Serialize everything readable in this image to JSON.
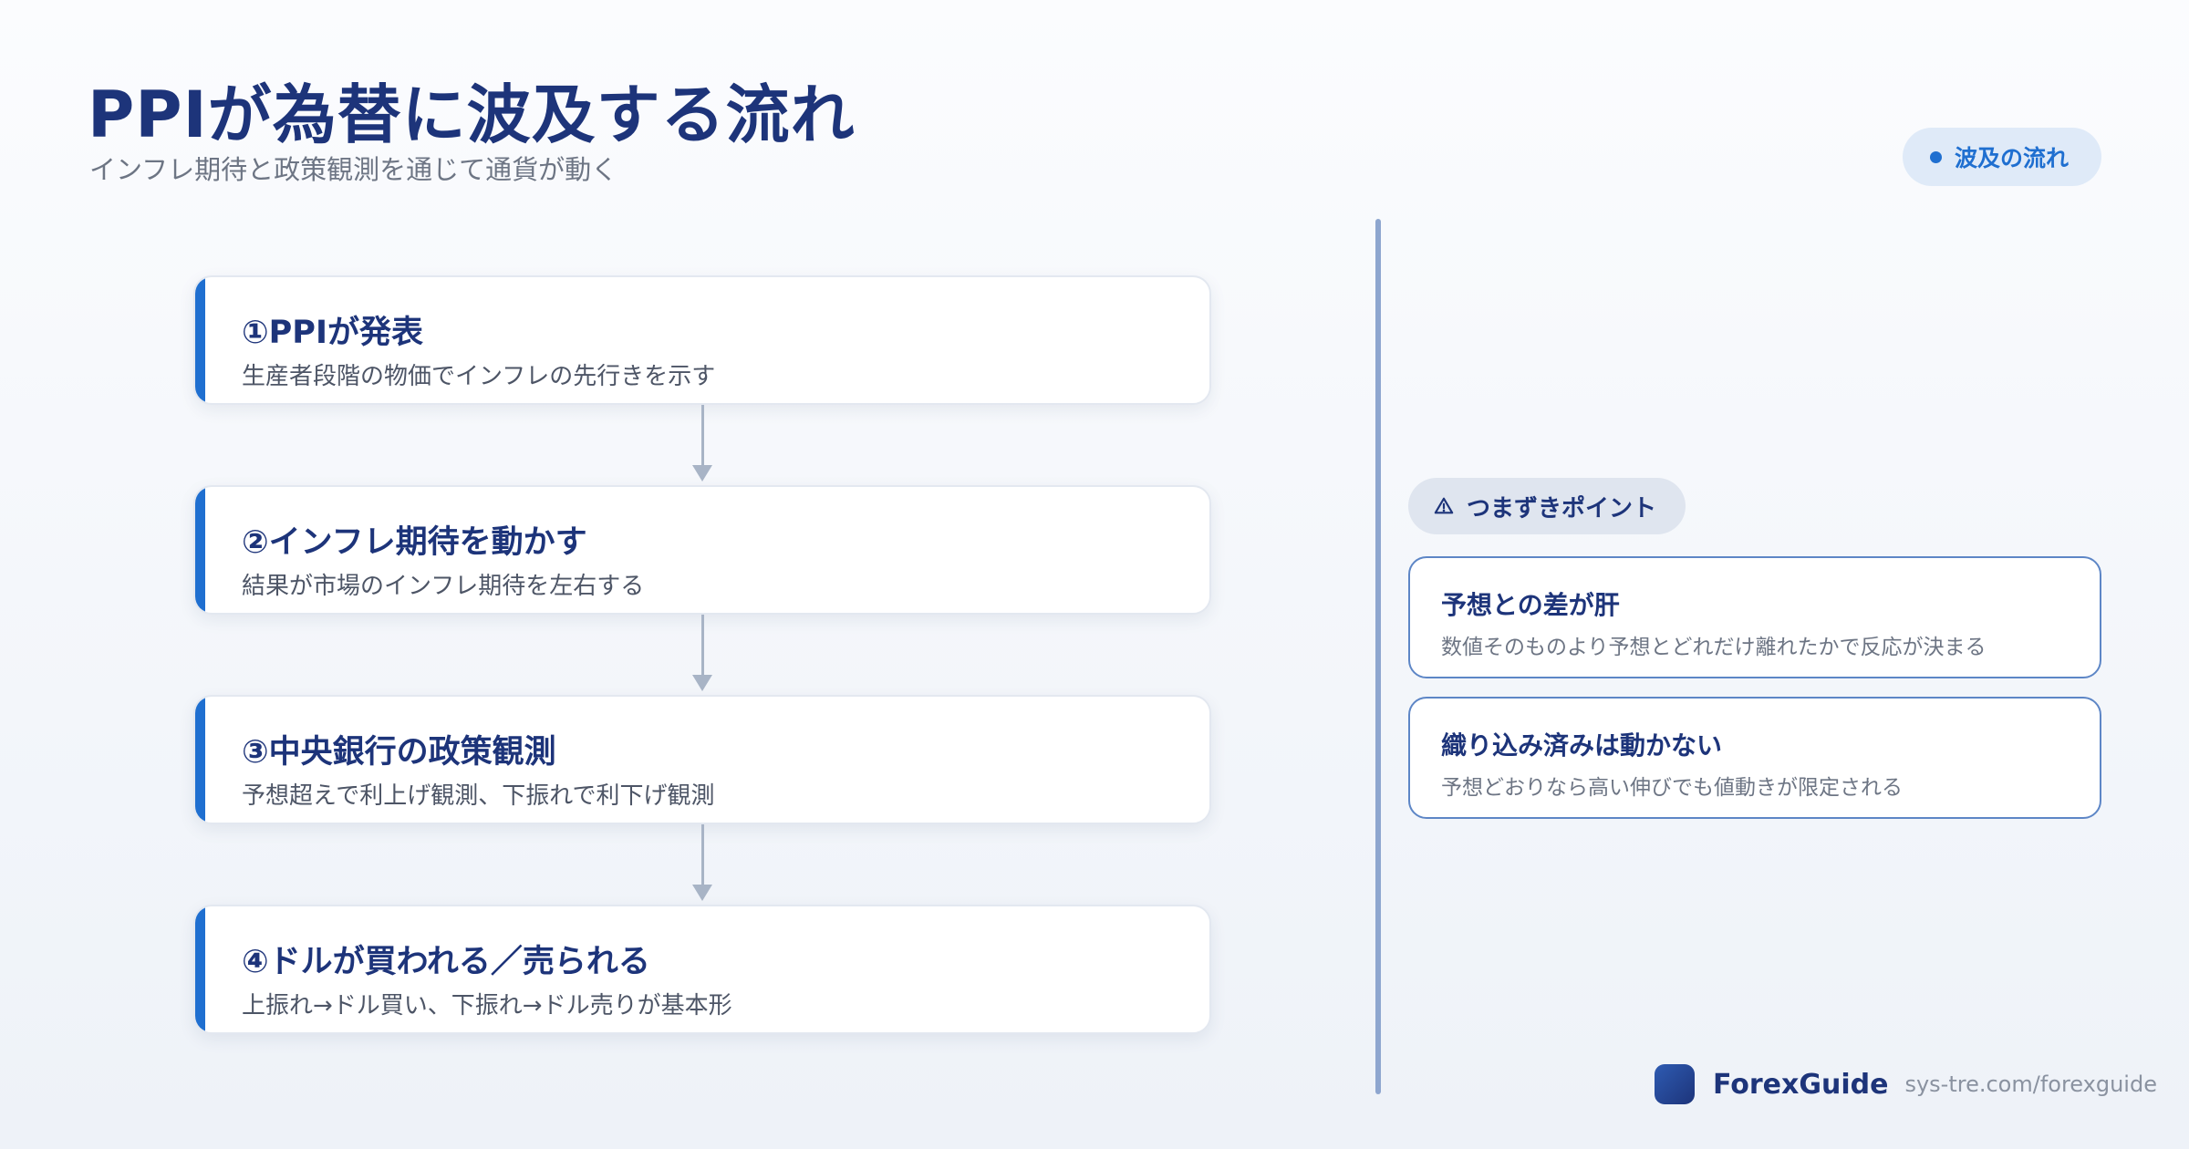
{
  "header": {
    "title": "PPIが為替に波及する流れ",
    "subtitle": "インフレ期待と政策観測を通じて通貨が動く",
    "badge_label": "波及の流れ"
  },
  "steps": [
    {
      "title": "①PPIが発表",
      "desc": "生産者段階の物価でインフレの先行きを示す"
    },
    {
      "title": "②インフレ期待を動かす",
      "desc": "結果が市場のインフレ期待を左右する"
    },
    {
      "title": "③中央銀行の政策観測",
      "desc": "予想超えで利上げ観測、下振れで利下げ観測"
    },
    {
      "title": "④ドルが買われる／売られる",
      "desc": "上振れ→ドル買い、下振れ→ドル売りが基本形"
    }
  ],
  "pitfalls": {
    "label": "つまずきポイント",
    "icon": "warning-icon",
    "items": [
      {
        "title": "予想との差が肝",
        "desc": "数値そのものより予想とどれだけ離れたかで反応が決まる"
      },
      {
        "title": "織り込み済みは動かない",
        "desc": "予想どおりなら高い伸びでも値動きが限定される"
      }
    ]
  },
  "footer": {
    "brand": "ForexGuide",
    "url": "sys-tre.com/forexguide"
  },
  "colors": {
    "accent": "#1f6fd0",
    "navy": "#1d347a",
    "divider": "#8ea6cf"
  }
}
